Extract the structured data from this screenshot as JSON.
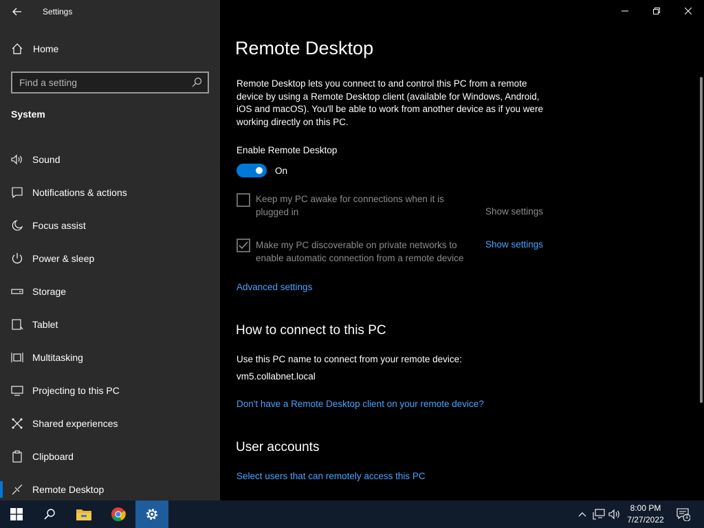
{
  "window": {
    "title": "Settings"
  },
  "sidebar": {
    "home_label": "Home",
    "search_placeholder": "Find a setting",
    "section_label": "System",
    "items": [
      {
        "label": "Sound",
        "icon": "speaker-icon"
      },
      {
        "label": "Notifications & actions",
        "icon": "notifications-icon"
      },
      {
        "label": "Focus assist",
        "icon": "moon-icon"
      },
      {
        "label": "Power & sleep",
        "icon": "power-icon"
      },
      {
        "label": "Storage",
        "icon": "storage-icon"
      },
      {
        "label": "Tablet",
        "icon": "tablet-icon"
      },
      {
        "label": "Multitasking",
        "icon": "multitasking-icon"
      },
      {
        "label": "Projecting to this PC",
        "icon": "projecting-icon"
      },
      {
        "label": "Shared experiences",
        "icon": "shared-experiences-icon"
      },
      {
        "label": "Clipboard",
        "icon": "clipboard-icon"
      },
      {
        "label": "Remote Desktop",
        "icon": "remote-desktop-icon",
        "active": true
      }
    ]
  },
  "main": {
    "title": "Remote Desktop",
    "description": "Remote Desktop lets you connect to and control this PC from a remote device by using a Remote Desktop client (available for Windows, Android, iOS and macOS). You'll be able to work from another device as if you were working directly on this PC.",
    "enable_label": "Enable Remote Desktop",
    "toggle_state": "On",
    "option1": {
      "text": "Keep my PC awake for connections when it is plugged in",
      "checked": false,
      "link": "Show settings"
    },
    "option2": {
      "text": "Make my PC discoverable on private networks to enable automatic connection from a remote device",
      "checked": true,
      "link": "Show settings"
    },
    "advanced_link": "Advanced settings",
    "connect_heading": "How to connect to this PC",
    "connect_desc": "Use this PC name to connect from your remote device:",
    "pc_name": "vm5.collabnet.local",
    "client_link": "Don't have a Remote Desktop client on your remote device?",
    "accounts_heading": "User accounts",
    "accounts_link": "Select users that can remotely access this PC"
  },
  "taskbar": {
    "time": "8:00 PM",
    "date": "7/27/2022",
    "notification_count": "1"
  },
  "colors": {
    "accent": "#0078d7",
    "link": "#4aa3ff",
    "sidebar_bg": "#2b2b2b",
    "taskbar_bg": "#101c2c"
  }
}
